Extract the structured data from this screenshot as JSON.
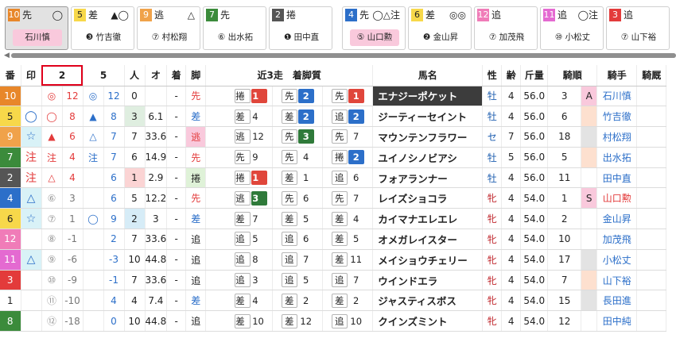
{
  "cards": [
    {
      "num": "10",
      "num_bg": "#e8872a",
      "num_color": "#ffffff",
      "leg": "先",
      "marks": "◯",
      "jockey": "石川慎",
      "jockey_style": "pink",
      "selected": true
    },
    {
      "num": "5",
      "num_bg": "#f7d84a",
      "num_color": "#222222",
      "leg": "差",
      "marks": "▲◯",
      "jockey": "❸ 竹吉徹",
      "jockey_style": "plain",
      "selected": false
    },
    {
      "num": "9",
      "num_bg": "#f0a24a",
      "num_color": "#ffffff",
      "leg": "逃",
      "marks": "△",
      "jockey": "⑦ 村松翔",
      "jockey_style": "plain",
      "selected": false
    },
    {
      "num": "7",
      "num_bg": "#3b8b3b",
      "num_color": "#ffffff",
      "leg": "先",
      "marks": "",
      "jockey": "⑥ 出水拓",
      "jockey_style": "plain",
      "selected": false
    },
    {
      "num": "2",
      "num_bg": "#555555",
      "num_color": "#ffffff",
      "leg": "捲",
      "marks": "",
      "jockey": "❶ 田中直",
      "jockey_style": "plain",
      "selected": false
    },
    {
      "num": "4",
      "num_bg": "#2c6fc9",
      "num_color": "#ffffff",
      "leg": "先",
      "marks": "◯△注",
      "jockey": "⑤ 山口勲",
      "jockey_style": "pink",
      "selected": false
    },
    {
      "num": "6",
      "num_bg": "#f7d84a",
      "num_color": "#222222",
      "leg": "差",
      "marks": "◎◎",
      "jockey": "❷ 金山昇",
      "jockey_style": "plain",
      "selected": false
    },
    {
      "num": "12",
      "num_bg": "#f07cb8",
      "num_color": "#ffffff",
      "leg": "追",
      "marks": "",
      "jockey": "⑦ 加茂飛",
      "jockey_style": "plain",
      "selected": false
    },
    {
      "num": "11",
      "num_bg": "#e46ad1",
      "num_color": "#ffffff",
      "leg": "追",
      "marks": "◯注",
      "jockey": "⑩ 小松丈",
      "jockey_style": "plain",
      "selected": false
    },
    {
      "num": "3",
      "num_bg": "#e33b3b",
      "num_color": "#ffffff",
      "leg": "追",
      "marks": "",
      "jockey": "⑦ 山下裕",
      "jockey_style": "plain",
      "selected": false
    }
  ],
  "headers": {
    "ban": "番",
    "shirushi": "印",
    "col2": "2",
    "col5": "5",
    "ninki": "人",
    "odds": "オ",
    "chaku": "着",
    "kyaku": "脚",
    "recent": "近3走　着脚質",
    "bamei": "馬名",
    "sei": "性",
    "rei": "齢",
    "kinryo": "斤量",
    "kijun": "騎順",
    "kishu": "騎手",
    "kyusha": "騎厩"
  },
  "rows": [
    {
      "ban": "10",
      "ban_bg": "#e8872a",
      "ban_color": "#fff",
      "mark": "",
      "mark_bg": "#fff",
      "c1m": "◎",
      "c1m_color": "#e33b3b",
      "c1v": "12",
      "c2m": "◎",
      "c2m_color": "#2c6fc9",
      "c2v": "12",
      "ninki": "0",
      "odds": "",
      "chaku": "-",
      "leg": "先",
      "leg_color": "#e33b3b",
      "leg_bg": "#fff",
      "r1l": "捲",
      "r1n": "1",
      "r1c": "#e0463b",
      "r2l": "先",
      "r2n": "2",
      "r2c": "#2c6fc9",
      "r3l": "先",
      "r3n": "1",
      "r3c": "#e0463b",
      "name": "エナジーポケット",
      "name_hl": true,
      "sex": "牡",
      "sex_cls": "m",
      "age": "4",
      "kin": "56.0",
      "kijun": "3",
      "kijun_bg": "#f9c9dc",
      "flag": "A",
      "jockey": "石川慎"
    },
    {
      "ban": "5",
      "ban_bg": "#f7d84a",
      "ban_color": "#222",
      "mark": "◯",
      "mark_bg": "#fff",
      "c1m": "◯",
      "c1m_color": "#e33b3b",
      "c1v": "8",
      "c2m": "▲",
      "c2m_color": "#2c6fc9",
      "c2v": "8",
      "ninki": "3",
      "ninki_bg": "#dfeee0",
      "odds": "6.1",
      "chaku": "-",
      "leg": "差",
      "leg_color": "#2c6fc9",
      "leg_bg": "#fff",
      "r1l": "差",
      "r1n": "4",
      "r1c": "",
      "r2l": "差",
      "r2n": "2",
      "r2c": "#2c6fc9",
      "r3l": "追",
      "r3n": "2",
      "r3c": "#2c6fc9",
      "name": "ジーティーセイント",
      "name_hl": false,
      "sex": "牡",
      "sex_cls": "m",
      "age": "4",
      "kin": "56.0",
      "kijun": "6",
      "kijun_bg": "#fde0cf",
      "flag": "",
      "jockey": "竹吉徹"
    },
    {
      "ban": "9",
      "ban_bg": "#f0a24a",
      "ban_color": "#fff",
      "mark": "☆",
      "mark_bg": "#d9f2f7",
      "c1m": "▲",
      "c1m_color": "#e33b3b",
      "c1v": "6",
      "c2m": "△",
      "c2m_color": "#2c6fc9",
      "c2v": "7",
      "ninki": "7",
      "odds": "33.6",
      "chaku": "-",
      "leg": "逃",
      "leg_color": "#e33b3b",
      "leg_bg": "#f9c9dc",
      "r1l": "逃",
      "r1n": "12",
      "r1c": "",
      "r2l": "先",
      "r2n": "3",
      "r2c": "#2f7a3a",
      "r3l": "先",
      "r3n": "7",
      "r3c": "",
      "name": "マウンテンフラワー",
      "name_hl": false,
      "sex": "セ",
      "sex_cls": "m",
      "age": "7",
      "kin": "56.0",
      "kijun": "18",
      "kijun_bg": "#e3e3e3",
      "flag": "",
      "jockey": "村松翔"
    },
    {
      "ban": "7",
      "ban_bg": "#3b8b3b",
      "ban_color": "#fff",
      "mark": "注",
      "mark_bg": "#fff",
      "c1m": "注",
      "c1m_color": "#e33b3b",
      "c1v": "4",
      "c2m": "注",
      "c2m_color": "#2c6fc9",
      "c2v": "7",
      "ninki": "6",
      "odds": "14.9",
      "chaku": "-",
      "leg": "先",
      "leg_color": "#e33b3b",
      "leg_bg": "#fff",
      "r1l": "先",
      "r1n": "9",
      "r1c": "",
      "r2l": "先",
      "r2n": "4",
      "r2c": "",
      "r3l": "捲",
      "r3n": "2",
      "r3c": "#2c6fc9",
      "name": "ユイノシノビアシ",
      "name_hl": false,
      "sex": "牡",
      "sex_cls": "m",
      "age": "5",
      "kin": "56.0",
      "kijun": "5",
      "kijun_bg": "#fde0cf",
      "flag": "",
      "jockey": "出水拓"
    },
    {
      "ban": "2",
      "ban_bg": "#555555",
      "ban_color": "#fff",
      "mark": "注",
      "mark_bg": "#fff",
      "c1m": "△",
      "c1m_color": "#e33b3b",
      "c1v": "4",
      "c2m": "",
      "c2m_color": "#2c6fc9",
      "c2v": "6",
      "ninki": "1",
      "ninki_bg": "#fbd4d4",
      "odds": "2.9",
      "chaku": "-",
      "leg": "捲",
      "leg_color": "#222",
      "leg_bg": "#dff2d8",
      "r1l": "捲",
      "r1n": "1",
      "r1c": "#e0463b",
      "r2l": "差",
      "r2n": "1",
      "r2c": "",
      "r3l": "追",
      "r3n": "6",
      "r3c": "",
      "name": "フォアランナー",
      "name_hl": false,
      "sex": "牡",
      "sex_cls": "m",
      "age": "4",
      "kin": "56.0",
      "kijun": "11",
      "kijun_bg": "#fff",
      "flag": "",
      "jockey": "田中直"
    },
    {
      "ban": "4",
      "ban_bg": "#2c6fc9",
      "ban_color": "#fff",
      "mark": "△",
      "mark_bg": "#d9f2f7",
      "c1m": "⑥",
      "c1m_color": "#999",
      "c1v": "3",
      "c2m": "",
      "c2m_color": "#2c6fc9",
      "c2v": "6",
      "ninki": "5",
      "odds": "12.2",
      "chaku": "-",
      "leg": "先",
      "leg_color": "#e33b3b",
      "leg_bg": "#fff",
      "r1l": "逃",
      "r1n": "3",
      "r1c": "#2f7a3a",
      "r2l": "先",
      "r2n": "6",
      "r2c": "",
      "r3l": "先",
      "r3n": "7",
      "r3c": "",
      "name": "レイズショコラ",
      "name_hl": false,
      "sex": "牝",
      "sex_cls": "f",
      "age": "4",
      "kin": "54.0",
      "kijun": "1",
      "kijun_bg": "#f9c9dc",
      "flag": "S",
      "jockey": "山口勲"
    },
    {
      "ban": "6",
      "ban_bg": "#f7d84a",
      "ban_color": "#222",
      "mark": "☆",
      "mark_bg": "#d9f2f7",
      "c1m": "⑦",
      "c1m_color": "#999",
      "c1v": "1",
      "c2m": "◯",
      "c2m_color": "#2c6fc9",
      "c2v": "9",
      "ninki": "2",
      "ninki_bg": "#d6ecf7",
      "odds": "3",
      "chaku": "-",
      "leg": "差",
      "leg_color": "#2c6fc9",
      "leg_bg": "#fff",
      "r1l": "差",
      "r1n": "7",
      "r1c": "",
      "r2l": "差",
      "r2n": "5",
      "r2c": "",
      "r3l": "差",
      "r3n": "4",
      "r3c": "",
      "name": "カイマナエレエレ",
      "name_hl": false,
      "sex": "牝",
      "sex_cls": "f",
      "age": "4",
      "kin": "54.0",
      "kijun": "2",
      "kijun_bg": "#fff",
      "flag": "",
      "jockey": "金山昇"
    },
    {
      "ban": "12",
      "ban_bg": "#f07cb8",
      "ban_color": "#fff",
      "mark": "",
      "mark_bg": "#fff",
      "c1m": "⑧",
      "c1m_color": "#999",
      "c1v": "-1",
      "c2m": "",
      "c2m_color": "#2c6fc9",
      "c2v": "2",
      "ninki": "7",
      "odds": "33.6",
      "chaku": "-",
      "leg": "追",
      "leg_color": "#222",
      "leg_bg": "#fff",
      "r1l": "追",
      "r1n": "5",
      "r1c": "",
      "r2l": "追",
      "r2n": "6",
      "r2c": "",
      "r3l": "差",
      "r3n": "5",
      "r3c": "",
      "name": "オメガレイスター",
      "name_hl": false,
      "sex": "牝",
      "sex_cls": "f",
      "age": "4",
      "kin": "54.0",
      "kijun": "10",
      "kijun_bg": "#fff",
      "flag": "",
      "jockey": "加茂飛"
    },
    {
      "ban": "11",
      "ban_bg": "#e46ad1",
      "ban_color": "#fff",
      "mark": "△",
      "mark_bg": "#d9f2f7",
      "c1m": "⑨",
      "c1m_color": "#999",
      "c1v": "-6",
      "c2m": "",
      "c2m_color": "#2c6fc9",
      "c2v": "-3",
      "ninki": "10",
      "odds": "44.8",
      "chaku": "-",
      "leg": "追",
      "leg_color": "#222",
      "leg_bg": "#fff",
      "r1l": "追",
      "r1n": "8",
      "r1c": "",
      "r2l": "追",
      "r2n": "7",
      "r2c": "",
      "r3l": "差",
      "r3n": "11",
      "r3c": "",
      "name": "メイショウチェリー",
      "name_hl": false,
      "sex": "牝",
      "sex_cls": "f",
      "age": "4",
      "kin": "54.0",
      "kijun": "17",
      "kijun_bg": "#e3e3e3",
      "flag": "",
      "jockey": "小松丈"
    },
    {
      "ban": "3",
      "ban_bg": "#e33b3b",
      "ban_color": "#fff",
      "mark": "",
      "mark_bg": "#fff",
      "c1m": "⑩",
      "c1m_color": "#999",
      "c1v": "-9",
      "c2m": "",
      "c2m_color": "#2c6fc9",
      "c2v": "-1",
      "ninki": "7",
      "odds": "33.6",
      "chaku": "-",
      "leg": "追",
      "leg_color": "#222",
      "leg_bg": "#fff",
      "r1l": "追",
      "r1n": "3",
      "r1c": "",
      "r2l": "追",
      "r2n": "5",
      "r2c": "",
      "r3l": "追",
      "r3n": "7",
      "r3c": "",
      "name": "ウインドエラ",
      "name_hl": false,
      "sex": "牝",
      "sex_cls": "f",
      "age": "4",
      "kin": "54.0",
      "kijun": "7",
      "kijun_bg": "#fde0cf",
      "flag": "",
      "jockey": "山下裕"
    },
    {
      "ban": "1",
      "ban_bg": "#ffffff",
      "ban_color": "#222",
      "mark": "",
      "mark_bg": "#fff",
      "c1m": "⑪",
      "c1m_color": "#999",
      "c1v": "-10",
      "c2m": "",
      "c2m_color": "#2c6fc9",
      "c2v": "4",
      "ninki": "4",
      "odds": "7.4",
      "chaku": "-",
      "leg": "差",
      "leg_color": "#2c6fc9",
      "leg_bg": "#fff",
      "r1l": "差",
      "r1n": "4",
      "r1c": "",
      "r2l": "差",
      "r2n": "2",
      "r2c": "",
      "r3l": "差",
      "r3n": "2",
      "r3c": "",
      "name": "ジャスティスボス",
      "name_hl": false,
      "sex": "牝",
      "sex_cls": "f",
      "age": "4",
      "kin": "54.0",
      "kijun": "15",
      "kijun_bg": "#e3e3e3",
      "flag": "",
      "jockey": "長田進"
    },
    {
      "ban": "8",
      "ban_bg": "#3b8b3b",
      "ban_color": "#fff",
      "mark": "",
      "mark_bg": "#fff",
      "c1m": "⑫",
      "c1m_color": "#999",
      "c1v": "-18",
      "c2m": "",
      "c2m_color": "#2c6fc9",
      "c2v": "0",
      "ninki": "10",
      "odds": "44.8",
      "chaku": "-",
      "leg": "追",
      "leg_color": "#222",
      "leg_bg": "#fff",
      "r1l": "差",
      "r1n": "10",
      "r1c": "",
      "r2l": "差",
      "r2n": "12",
      "r2c": "",
      "r3l": "追",
      "r3n": "10",
      "r3c": "",
      "name": "クインズミント",
      "name_hl": false,
      "sex": "牝",
      "sex_cls": "f",
      "age": "4",
      "kin": "54.0",
      "kijun": "12",
      "kijun_bg": "#fff",
      "flag": "",
      "jockey": "田中純"
    }
  ]
}
